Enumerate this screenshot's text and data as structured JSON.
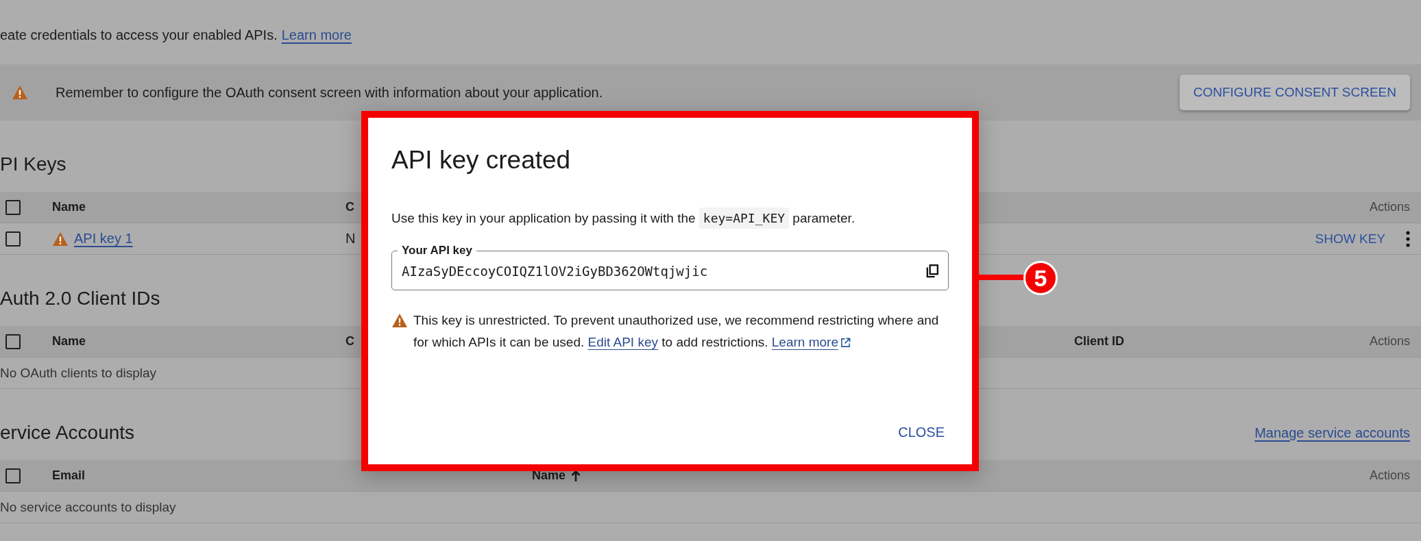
{
  "intro": {
    "text": "eate credentials to access your enabled APIs.",
    "link": "Learn more"
  },
  "banner": {
    "message": "Remember to configure the OAuth consent screen with information about your application.",
    "button": "CONFIGURE CONSENT SCREEN"
  },
  "api_keys": {
    "title": "PI Keys",
    "header": {
      "checked": false,
      "columns": [
        {
          "label": "Name",
          "sorted": false
        },
        {
          "label": "C",
          "sorted": false
        },
        {
          "label": "Actions",
          "sorted": false
        }
      ]
    },
    "rows": [
      {
        "checked": false,
        "warning": true,
        "name": "API key 1",
        "column_2": "N",
        "action": "SHOW KEY"
      }
    ]
  },
  "oauth_clients": {
    "title": "Auth 2.0 Client IDs",
    "header": {
      "checked": false,
      "columns": [
        {
          "label": "Name",
          "sorted": false
        },
        {
          "label": "C",
          "sorted": false
        },
        {
          "label": "Client ID",
          "sorted": false
        },
        {
          "label": "Actions",
          "sorted": false
        }
      ]
    },
    "empty_message": "No OAuth clients to display"
  },
  "service_accounts": {
    "title": "ervice Accounts",
    "link": "Manage service accounts",
    "header": {
      "checked": false,
      "columns": [
        {
          "label": "Email",
          "sorted": false
        },
        {
          "label": "Name",
          "sorted": true
        },
        {
          "label": "Actions",
          "sorted": false
        }
      ]
    },
    "empty_message": "No service accounts to display"
  },
  "dialog": {
    "title": "API key created",
    "instruction": {
      "before": "Use this key in your application by passing it with the ",
      "code": "key=API_KEY",
      "after": " parameter."
    },
    "field": {
      "label": "Your API key",
      "value": "AIzaSyDEccoyCOIQZ1lOV2iGyBD362OWtqjwjic"
    },
    "warning": {
      "text": "This key is unrestricted. To prevent unauthorized use, we recommend restricting where and for which APIs it can be used. ",
      "link": "Edit API key",
      "after": " to add restrictions. ",
      "learn_more": "Learn more"
    },
    "button": "CLOSE"
  },
  "callout_number": "5"
}
